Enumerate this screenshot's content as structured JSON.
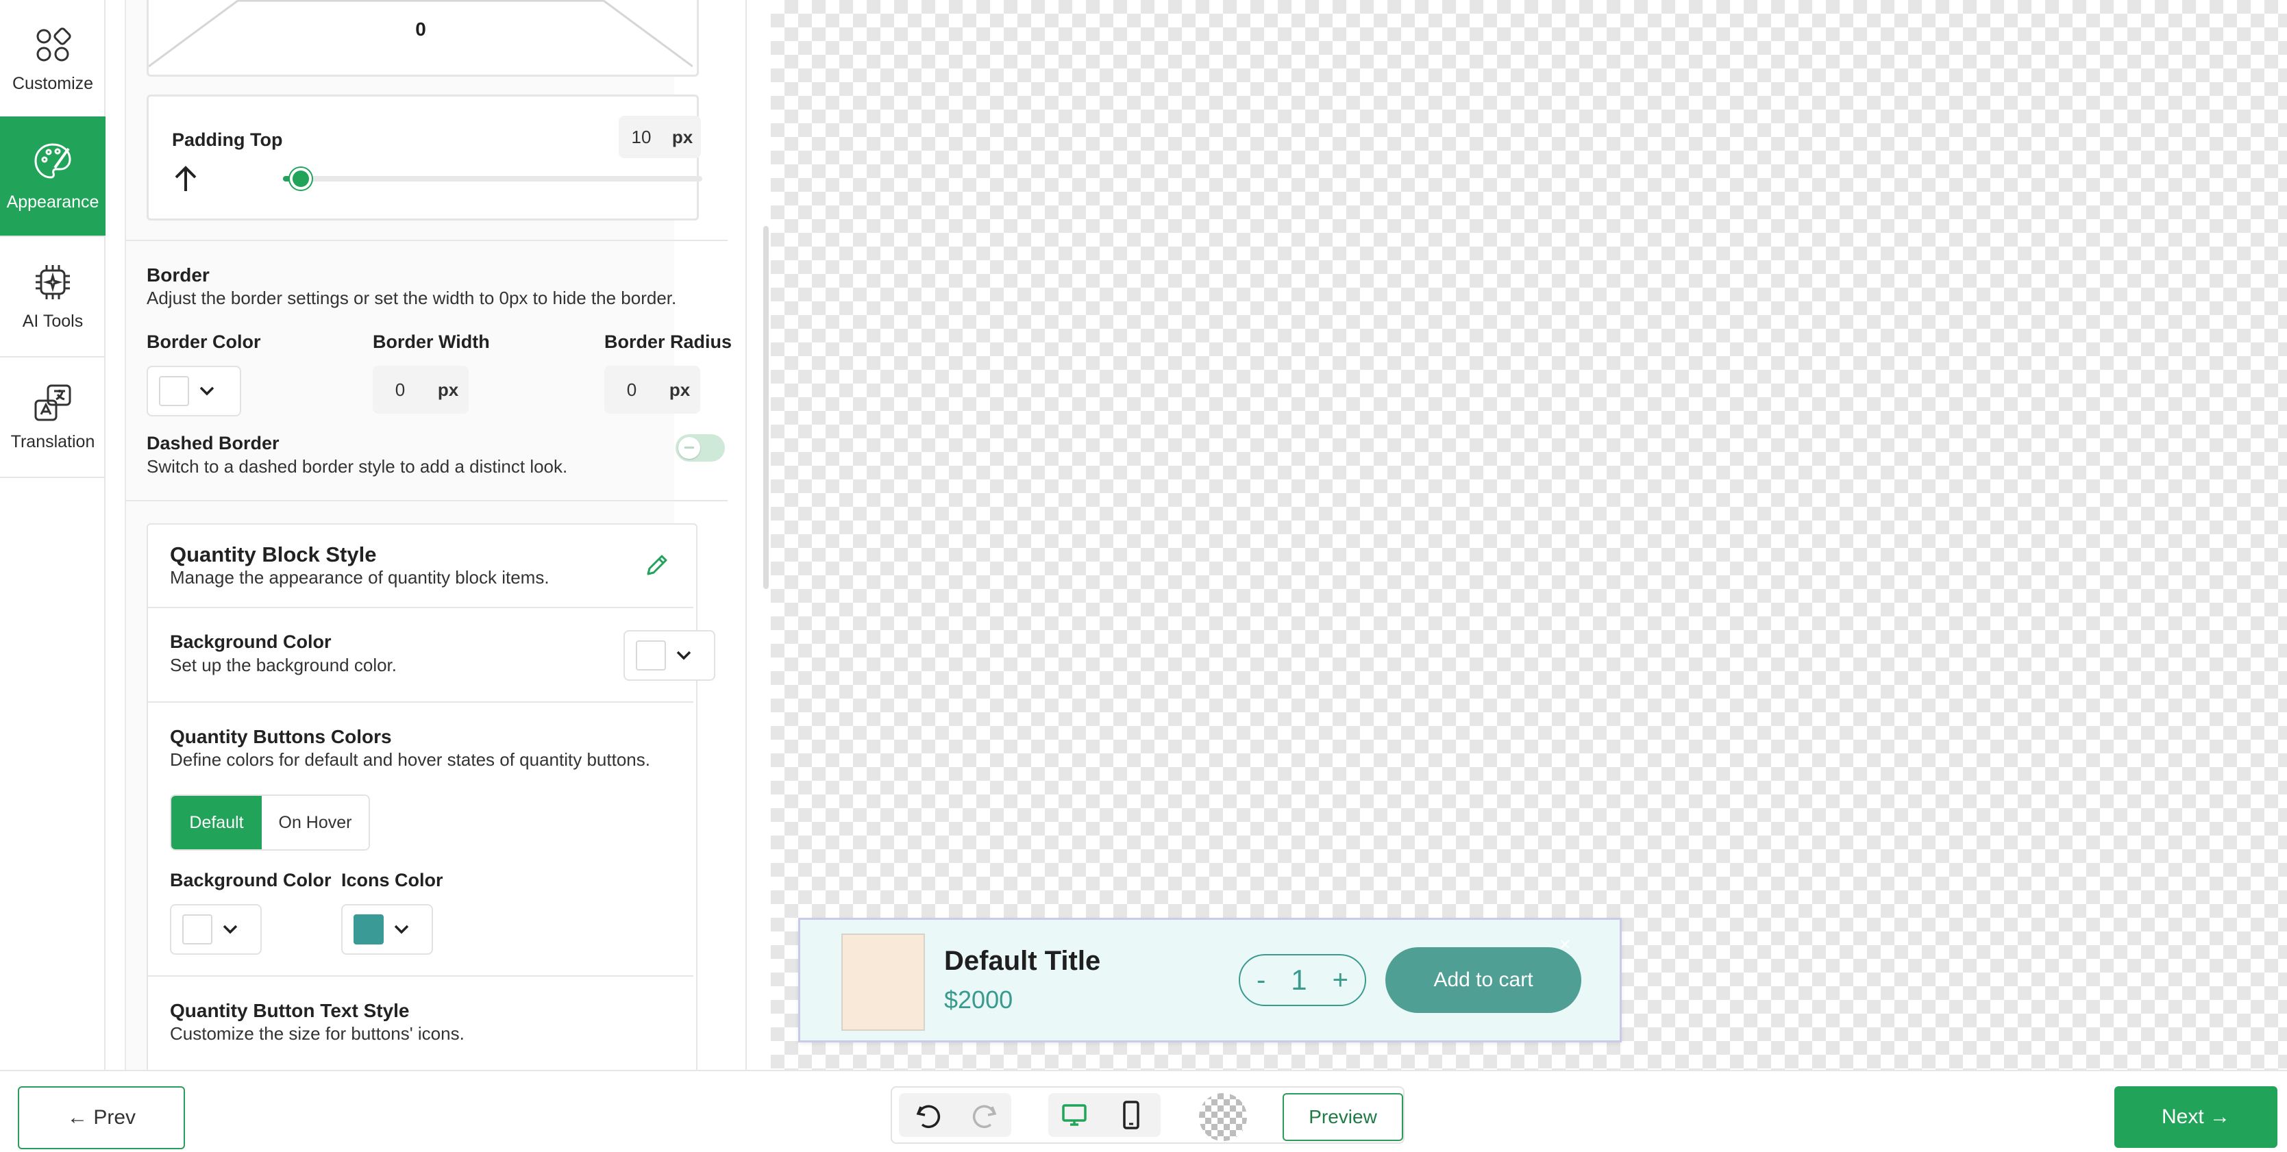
{
  "rail": {
    "items": [
      {
        "label": "Customize",
        "icon": "grid-shapes-icon"
      },
      {
        "label": "Appearance",
        "icon": "palette-icon"
      },
      {
        "label": "AI Tools",
        "icon": "ai-chip-icon"
      },
      {
        "label": "Translation",
        "icon": "translate-icon"
      }
    ]
  },
  "spacing": {
    "value": "0"
  },
  "padding_top": {
    "label": "Padding Top",
    "value": "10",
    "unit": "px",
    "slider_fraction": 0.04
  },
  "border": {
    "title": "Border",
    "desc": "Adjust the border settings or set the width to 0px to hide the border.",
    "color_label": "Border Color",
    "width_label": "Border Width",
    "width_value": "0",
    "width_unit": "px",
    "radius_label": "Border Radius",
    "radius_value": "0",
    "radius_unit": "px",
    "dashed_title": "Dashed Border",
    "dashed_desc": "Switch to a dashed border style to add a distinct look.",
    "dashed_enabled": false
  },
  "quantity_block": {
    "title": "Quantity Block Style",
    "desc": "Manage the appearance of quantity block items.",
    "bg_title": "Background Color",
    "bg_desc": "Set up the background color.",
    "buttons_title": "Quantity Buttons Colors",
    "buttons_desc": "Define colors for default and hover states of quantity buttons.",
    "tab_default": "Default",
    "tab_hover": "On Hover",
    "bg_color_label": "Background Color",
    "icons_color_label": "Icons Color",
    "icons_color": "#3a9a96",
    "text_style_title": "Quantity Button Text Style",
    "text_style_desc": "Customize the size for buttons' icons."
  },
  "preview_bar": {
    "title": "Default Title",
    "price": "$2000",
    "minus": "-",
    "qty": "1",
    "plus": "+",
    "add_to_cart": "Add to cart",
    "close": "×",
    "image_color": "#f8e9d8",
    "accent": "#3a9a8e"
  },
  "bottom": {
    "prev": "← Prev",
    "next": "Next →",
    "preview": "Preview"
  },
  "colors": {
    "brand_green": "#22a35a"
  }
}
